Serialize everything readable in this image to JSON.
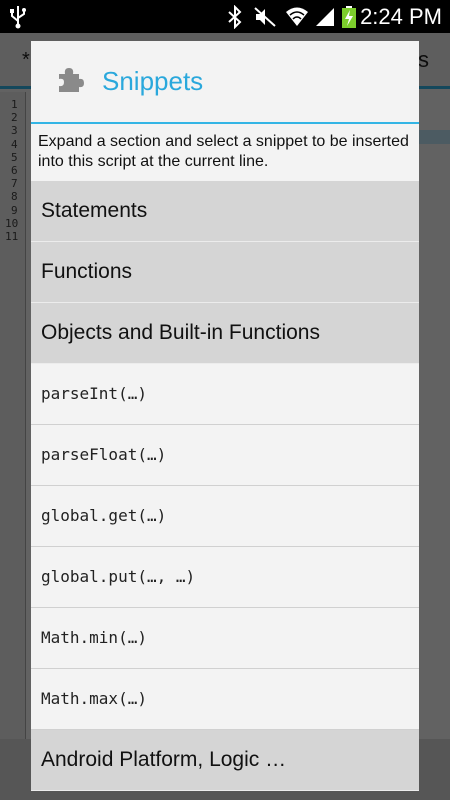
{
  "status_bar": {
    "time": "2:24 PM",
    "icons": [
      "usb-icon",
      "bluetooth-icon",
      "mute-icon",
      "wifi-icon",
      "signal-icon",
      "battery-charging-icon"
    ]
  },
  "background": {
    "toolbar_star": "*",
    "toolbar_fragment": "s",
    "line_numbers": [
      "1",
      "2",
      "3",
      "4",
      "5",
      "6",
      "7",
      "8",
      "9",
      "10",
      "11"
    ]
  },
  "dialog": {
    "icon": "puzzle-piece-icon",
    "title": "Snippets",
    "description": "Expand a section and select a snippet to be inserted into this script at the current line.",
    "sections": [
      {
        "label": "Statements"
      },
      {
        "label": "Functions"
      },
      {
        "label": "Objects and Built-in Functions",
        "expanded": true,
        "items": [
          "parseInt(…)",
          "parseFloat(…)",
          "global.get(…)",
          "global.put(…, …)",
          "Math.min(…)",
          "Math.max(…)"
        ]
      },
      {
        "label": "Android Platform, Logic …"
      }
    ]
  },
  "colors": {
    "accent": "#33b5e5",
    "title": "#2aa8dc",
    "section_bg": "#d5d5d5",
    "dialog_bg": "#f3f3f3"
  }
}
